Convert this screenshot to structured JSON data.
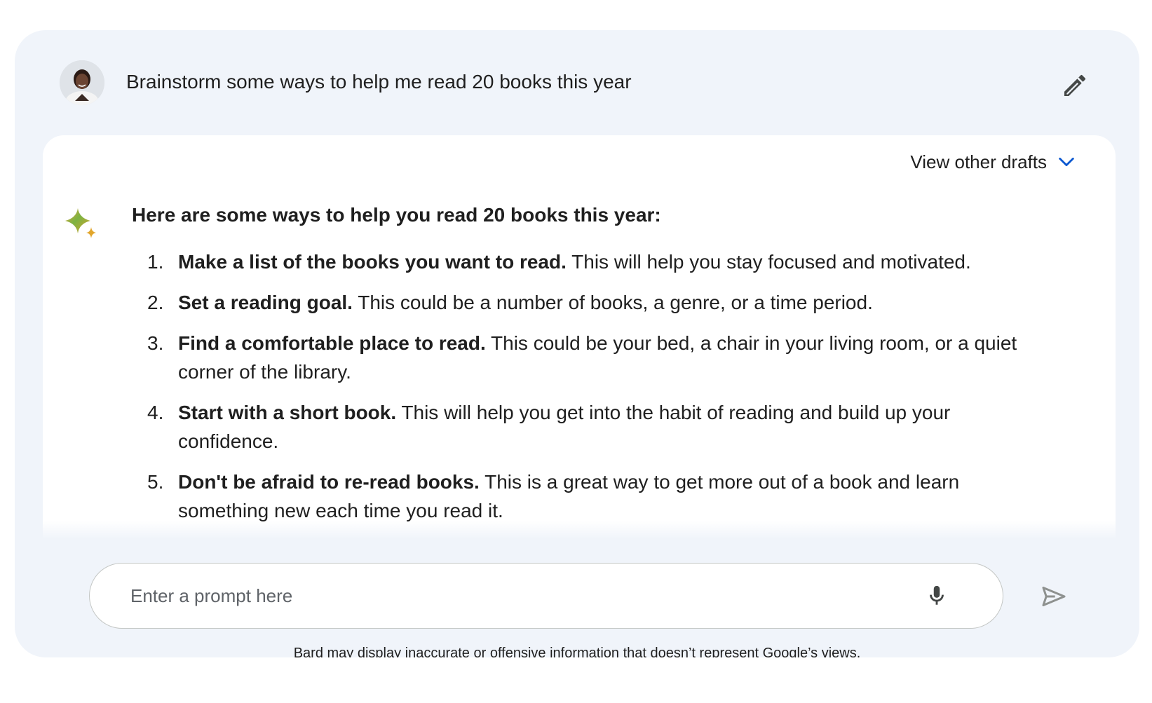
{
  "user": {
    "prompt": "Brainstorm some ways to help me read 20 books this year",
    "avatar_icon": "user-avatar-photo",
    "edit_icon": "pencil-icon"
  },
  "response": {
    "view_drafts_label": "View other drafts",
    "drafts_icon": "chevron-down-icon",
    "spark_icon": "bard-sparkle-icon",
    "intro": "Here are some ways to help you read 20 books this year:",
    "items": [
      {
        "number": "1.",
        "bold": "Make a list of the books you want to read.",
        "text": " This will help you stay focused and motivated."
      },
      {
        "number": "2.",
        "bold": "Set a reading goal.",
        "text": " This could be a number of books, a genre, or a time period."
      },
      {
        "number": "3.",
        "bold": "Find a comfortable place to read.",
        "text": " This could be your bed, a chair in your living room, or a quiet corner of the library."
      },
      {
        "number": "4.",
        "bold": "Start with a short book.",
        "text": " This will help you get into the habit of reading and build up your confidence."
      },
      {
        "number": "5.",
        "bold": "Don't be afraid to re-read books.",
        "text": " This is a great way to get more out of a book and learn something new each time you read it."
      }
    ]
  },
  "input": {
    "placeholder": "Enter a prompt here",
    "value": "",
    "mic_icon": "microphone-icon",
    "send_icon": "send-icon"
  },
  "disclaimer": "Bard may display inaccurate or offensive information that doesn’t represent Google’s views.",
  "colors": {
    "panel_background": "#f0f4fa",
    "card_background": "#ffffff",
    "accent_blue": "#0b57d0",
    "text_primary": "#1f1f1f",
    "icon_grey": "#444746",
    "send_disabled": "#8e918f"
  }
}
